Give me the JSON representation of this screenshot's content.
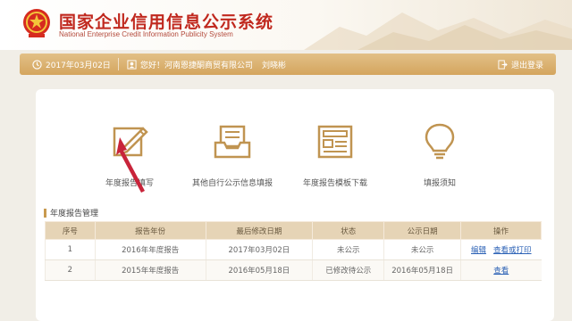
{
  "header": {
    "title_cn": "国家企业信用信息公示系统",
    "title_en": "National Enterprise Credit Information Publicity System"
  },
  "topbar": {
    "date": "2017年03月02日",
    "greeting": "您好！河南恩捷酮商贸有限公司",
    "user_name": "刘晓彬",
    "logout_label": "退出登录",
    "icons": [
      "clock-icon",
      "user-icon",
      "logout-icon"
    ]
  },
  "functions": [
    {
      "label": "年度报告填写",
      "icon": "edit-icon"
    },
    {
      "label": "其他自行公示信息填报",
      "icon": "inbox-icon"
    },
    {
      "label": "年度报告模板下载",
      "icon": "template-icon"
    },
    {
      "label": "填报须知",
      "icon": "lightbulb-icon"
    }
  ],
  "section": {
    "title": "年度报告管理"
  },
  "table": {
    "headers": [
      "序号",
      "报告年份",
      "最后修改日期",
      "状态",
      "公示日期",
      "操作"
    ],
    "rows": [
      {
        "index": "1",
        "year": "2016年年度报告",
        "modified": "2017年03月02日",
        "status": "未公示",
        "publish_date": "未公示",
        "actions": [
          "编辑",
          "查看或打印"
        ]
      },
      {
        "index": "2",
        "year": "2015年年度报告",
        "modified": "2016年05月18日",
        "status": "已修改待公示",
        "publish_date": "2016年05月18日",
        "actions": [
          "查看"
        ]
      }
    ]
  },
  "colors": {
    "brand_red": "#c0281e",
    "gold": "#d4a55e",
    "table_header": "#e6d4b6",
    "link": "#2b61b5",
    "annotation_arrow": "#c8243a"
  }
}
